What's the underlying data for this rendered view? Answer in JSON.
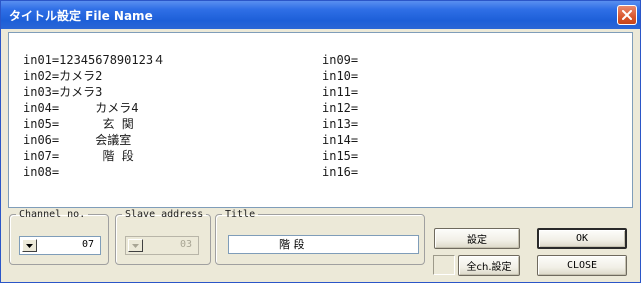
{
  "window": {
    "title": "タイトル設定 File Name"
  },
  "titles": {
    "left": [
      "in01=1234567890123４",
      "in02=カメラ2",
      "in03=カメラ3",
      "in04=     カメラ4",
      "in05=      玄 関",
      "in06=     会議室",
      "in07=      階 段",
      "in08="
    ],
    "right": [
      "in09=",
      "in10=",
      "in11=",
      "in12=",
      "in13=",
      "in14=",
      "in15=",
      "in16="
    ]
  },
  "channel": {
    "label": "Channel no.",
    "value": "07",
    "arrow_icon": "chevron-down-icon"
  },
  "slave": {
    "label": "Slave address",
    "value": "03",
    "arrow_icon": "chevron-down-icon"
  },
  "title_field": {
    "label": "Title",
    "value": "階 段"
  },
  "buttons": {
    "set": "設定",
    "ok": "OK",
    "all_set": "全ch.設定",
    "close": "CLOSE"
  },
  "colors": {
    "titlebar": "#1d5fd8",
    "close_button": "#d9572e",
    "window_face": "#ece9d8"
  }
}
